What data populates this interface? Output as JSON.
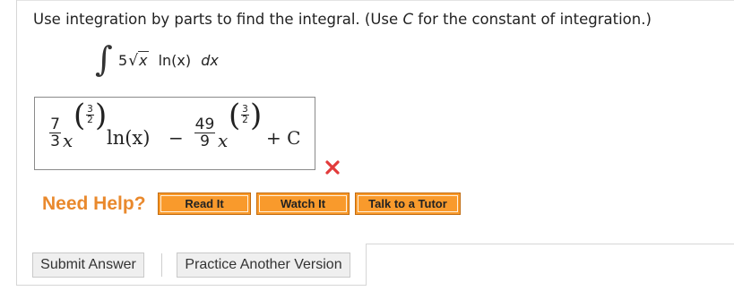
{
  "question": {
    "prefix": "Use integration by parts to find the integral. (Use ",
    "variable": "C",
    "suffix": " for the constant of integration.)"
  },
  "problem": {
    "integral_symbol": "∫",
    "coefficient": "5",
    "radical": "√",
    "radicand": "x",
    "function": "ln(x)",
    "differential": "dx"
  },
  "answer": {
    "term1_num": "7",
    "term1_den": "3",
    "var_x": "x",
    "exp_num": "3",
    "exp_den": "2",
    "ln_text": "ln(x)",
    "minus": "−",
    "term2_num": "49",
    "term2_den": "9",
    "plus_c": "+ C",
    "status": "incorrect",
    "status_icon": "close-icon",
    "status_color": "#e23b3b"
  },
  "help": {
    "label": "Need Help?",
    "buttons": [
      "Read It",
      "Watch It",
      "Talk to a Tutor"
    ],
    "accent": "#f99a2c"
  },
  "actions": {
    "submit": "Submit Answer",
    "practice": "Practice Another Version"
  }
}
